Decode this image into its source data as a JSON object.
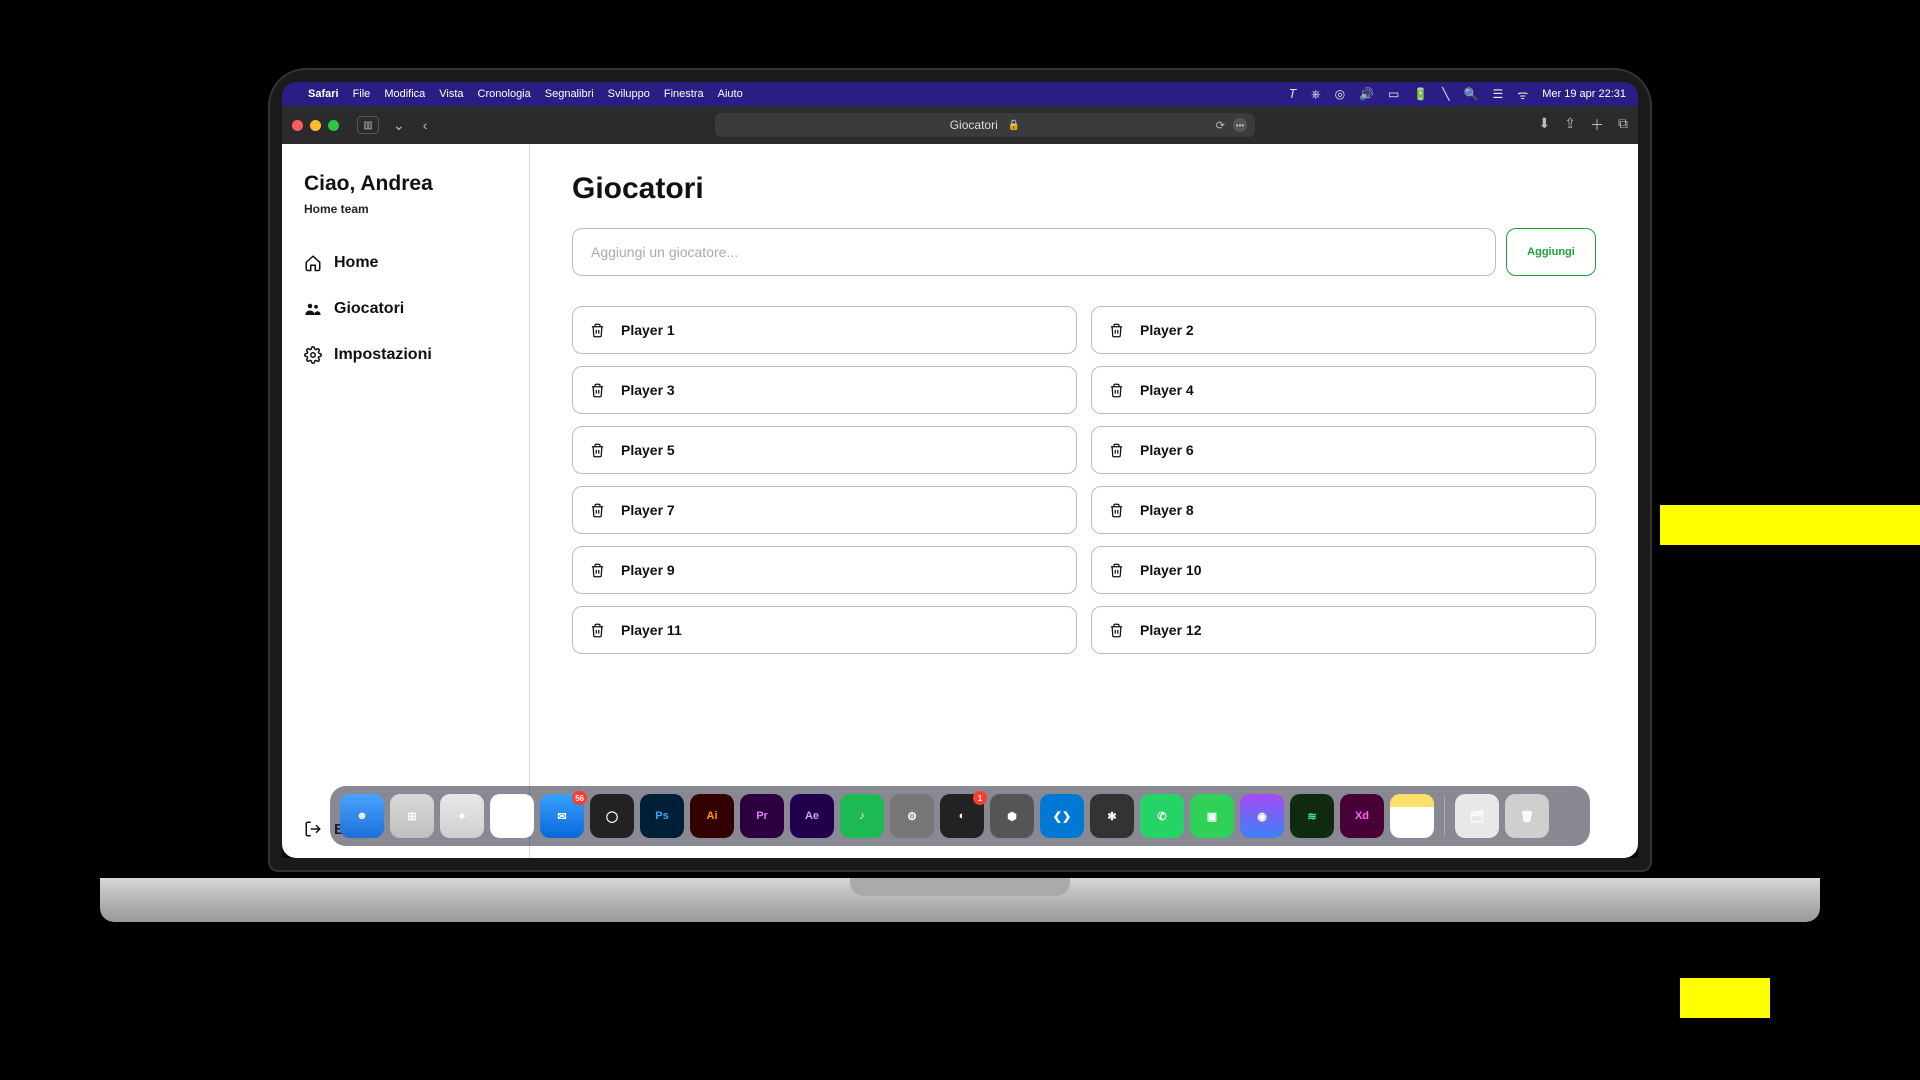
{
  "menubar": {
    "app": "Safari",
    "items": [
      "File",
      "Modifica",
      "Vista",
      "Cronologia",
      "Segnalibri",
      "Sviluppo",
      "Finestra",
      "Aiuto"
    ],
    "datetime": "Mer 19 apr  22:31"
  },
  "safari": {
    "page_title": "Giocatori"
  },
  "sidebar": {
    "greeting": "Ciao, Andrea",
    "team": "Home team",
    "items": [
      {
        "id": "home",
        "label": "Home"
      },
      {
        "id": "giocatori",
        "label": "Giocatori"
      },
      {
        "id": "impostazioni",
        "label": "Impostazioni"
      }
    ],
    "logout": "Esci"
  },
  "main": {
    "title": "Giocatori",
    "add_placeholder": "Aggiungi un giocatore...",
    "add_button": "Aggiungi",
    "players": [
      "Player 1",
      "Player 2",
      "Player 3",
      "Player 4",
      "Player 5",
      "Player 6",
      "Player 7",
      "Player 8",
      "Player 9",
      "Player 10",
      "Player 11",
      "Player 12"
    ]
  },
  "dock": {
    "mail_badge": "56",
    "unity_badge": "1",
    "apps": [
      {
        "id": "finder",
        "bg": "linear-gradient(#4aa3ff,#1e6fd8)",
        "label": "☻"
      },
      {
        "id": "launchpad",
        "bg": "linear-gradient(#d9d9d9,#bfbfbf)",
        "label": "⊞"
      },
      {
        "id": "safari",
        "bg": "linear-gradient(#e8e8e8,#cfcfcf)",
        "label": "✦"
      },
      {
        "id": "chrome",
        "bg": "#fff",
        "label": "◉"
      },
      {
        "id": "mail",
        "bg": "linear-gradient(#36a3ff,#0b66d8)",
        "label": "✉",
        "badge": "56"
      },
      {
        "id": "obs",
        "bg": "#222",
        "label": "◯"
      },
      {
        "id": "photoshop",
        "bg": "#001e36",
        "label": "Ps",
        "fg": "#31a8ff"
      },
      {
        "id": "illustrator",
        "bg": "#330000",
        "label": "Ai",
        "fg": "#ff9a00"
      },
      {
        "id": "premiere",
        "bg": "#2a003f",
        "label": "Pr",
        "fg": "#e879f9"
      },
      {
        "id": "aftereffects",
        "bg": "#1f004a",
        "label": "Ae",
        "fg": "#c7a3ff"
      },
      {
        "id": "spotify",
        "bg": "#1db954",
        "label": "♪"
      },
      {
        "id": "settings",
        "bg": "#777",
        "label": "⚙"
      },
      {
        "id": "cinema4d",
        "bg": "#222",
        "label": "◐",
        "badge": "1"
      },
      {
        "id": "unity",
        "bg": "#555",
        "label": "⬢"
      },
      {
        "id": "vscode",
        "bg": "#0078d4",
        "label": "❮❯"
      },
      {
        "id": "app2",
        "bg": "#333",
        "label": "✱"
      },
      {
        "id": "whatsapp",
        "bg": "#25d366",
        "label": "✆"
      },
      {
        "id": "facetime",
        "bg": "#30d158",
        "label": "▣"
      },
      {
        "id": "siri",
        "bg": "linear-gradient(#a64bf4,#3b82f6)",
        "label": "◉"
      },
      {
        "id": "audio",
        "bg": "#102a12",
        "label": "≋",
        "fg": "#3bf47a"
      },
      {
        "id": "xd",
        "bg": "#470137",
        "label": "Xd",
        "fg": "#ff61f6"
      },
      {
        "id": "notes",
        "bg": "linear-gradient(#ffe06b 30%,#fff 30%)",
        "label": ""
      }
    ],
    "right": [
      {
        "id": "folder",
        "bg": "#e8e8e8",
        "label": "🗂"
      },
      {
        "id": "trash",
        "bg": "#cfcfcf",
        "label": "🗑"
      }
    ]
  }
}
